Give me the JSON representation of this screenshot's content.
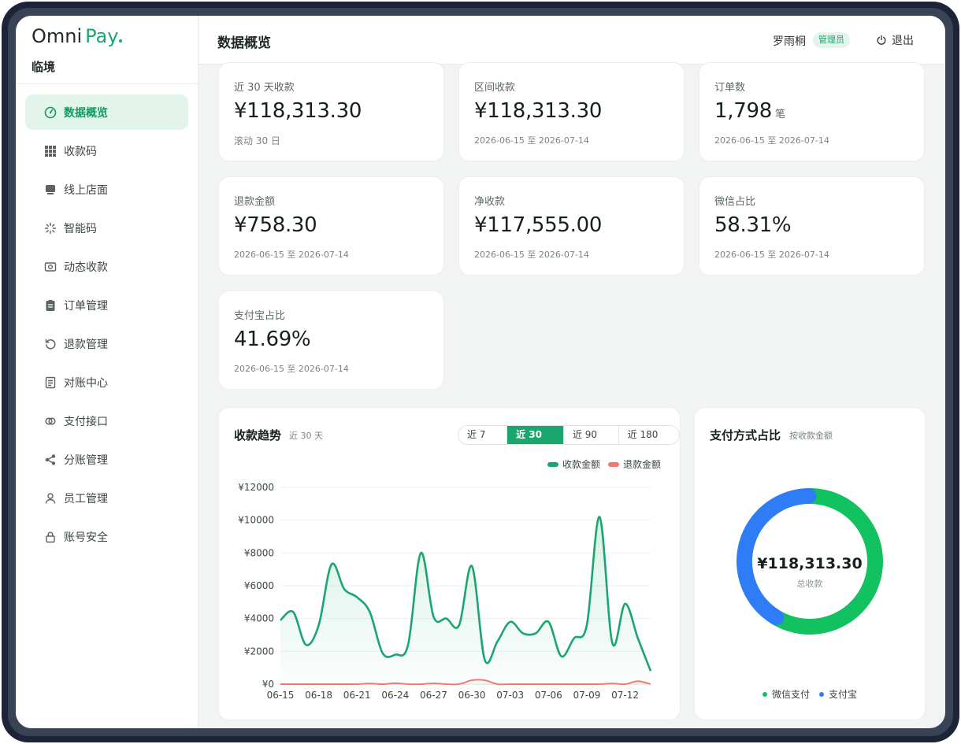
{
  "brand": {
    "omni": "Omni",
    "pay": "Pay",
    "store_name": "临境"
  },
  "colors": {
    "accent": "#1aa66e",
    "income": "#1aa66e",
    "refund": "#f07a72",
    "wechat": "#12c15f",
    "alipay": "#2f7df6"
  },
  "sidebar": {
    "items": [
      {
        "label": "数据概览",
        "icon": "dashboard-icon",
        "active": true
      },
      {
        "label": "收款码",
        "icon": "grid-icon"
      },
      {
        "label": "线上店面",
        "icon": "store-icon"
      },
      {
        "label": "智能码",
        "icon": "sparkle-icon"
      },
      {
        "label": "动态收款",
        "icon": "camera-icon"
      },
      {
        "label": "订单管理",
        "icon": "clipboard-icon"
      },
      {
        "label": "退款管理",
        "icon": "refund-icon"
      },
      {
        "label": "对账中心",
        "icon": "document-icon"
      },
      {
        "label": "支付接口",
        "icon": "link-icon"
      },
      {
        "label": "分账管理",
        "icon": "share-icon"
      },
      {
        "label": "员工管理",
        "icon": "user-icon"
      },
      {
        "label": "账号安全",
        "icon": "lock-icon"
      }
    ]
  },
  "header": {
    "title": "数据概览",
    "user_name": "罗雨桐",
    "role": "管理员",
    "logout_label": "退出"
  },
  "stats": [
    {
      "label": "近 30 天收款",
      "value": "¥118,313.30",
      "unit": "",
      "sub": "滚动 30 日"
    },
    {
      "label": "区间收款",
      "value": "¥118,313.30",
      "unit": "",
      "sub": "2026-06-15 至 2026-07-14"
    },
    {
      "label": "订单数",
      "value": "1,798",
      "unit": "笔",
      "sub": "2026-06-15 至 2026-07-14"
    },
    {
      "label": "退款金额",
      "value": "¥758.30",
      "unit": "",
      "sub": "2026-06-15 至 2026-07-14"
    },
    {
      "label": "净收款",
      "value": "¥117,555.00",
      "unit": "",
      "sub": "2026-06-15 至 2026-07-14"
    },
    {
      "label": "微信占比",
      "value": "58.31%",
      "unit": "",
      "sub": "2026-06-15 至 2026-07-14"
    },
    {
      "label": "支付宝占比",
      "value": "41.69%",
      "unit": "",
      "sub": "2026-06-15 至 2026-07-14"
    }
  ],
  "trend": {
    "title": "收款趋势",
    "subtitle": "近 30 天",
    "ranges": [
      {
        "label": "近 7 天",
        "active": false
      },
      {
        "label": "近 30 天",
        "active": true
      },
      {
        "label": "近 90 天",
        "active": false
      },
      {
        "label": "近 180 天",
        "active": false
      }
    ]
  },
  "chart_data": [
    {
      "type": "area",
      "categories": [
        "06-15",
        "06-16",
        "06-17",
        "06-18",
        "06-19",
        "06-20",
        "06-21",
        "06-22",
        "06-23",
        "06-24",
        "06-25",
        "06-26",
        "06-27",
        "06-28",
        "06-29",
        "06-30",
        "07-01",
        "07-02",
        "07-03",
        "07-04",
        "07-05",
        "07-06",
        "07-07",
        "07-08",
        "07-09",
        "07-10",
        "07-11",
        "07-12",
        "07-13",
        "07-14"
      ],
      "x_tick_labels": [
        "06-15",
        "06-18",
        "06-21",
        "06-24",
        "06-27",
        "06-30",
        "07-03",
        "07-06",
        "07-09",
        "07-12"
      ],
      "y_tick_labels": [
        "¥0",
        "¥2000",
        "¥4000",
        "¥6000",
        "¥8000",
        "¥10000",
        "¥12000"
      ],
      "ylim": [
        0,
        12000
      ],
      "grid": true,
      "legend_position": "top-right",
      "series": [
        {
          "name": "收款金额",
          "values": [
            3900,
            4400,
            2400,
            3600,
            7300,
            5800,
            5300,
            4400,
            1900,
            1800,
            2400,
            8000,
            4100,
            4000,
            3600,
            7200,
            1500,
            2600,
            3800,
            3100,
            3100,
            3800,
            1700,
            2800,
            3600,
            10200,
            2500,
            4900,
            2800,
            800
          ]
        },
        {
          "name": "退款金额",
          "values": [
            0,
            0,
            0,
            0,
            0,
            0,
            0,
            40,
            0,
            60,
            0,
            0,
            50,
            0,
            0,
            240,
            240,
            0,
            0,
            0,
            0,
            0,
            0,
            0,
            0,
            0,
            40,
            0,
            180,
            0
          ]
        }
      ]
    },
    {
      "type": "pie",
      "title": "支付方式占比",
      "subtitle": "按收款金额",
      "center_value": "¥118,313.30",
      "center_label": "总收款",
      "legend_position": "bottom",
      "series": [
        {
          "name": "微信支付",
          "value": 58.31
        },
        {
          "name": "支付宝",
          "value": 41.69
        }
      ]
    }
  ]
}
